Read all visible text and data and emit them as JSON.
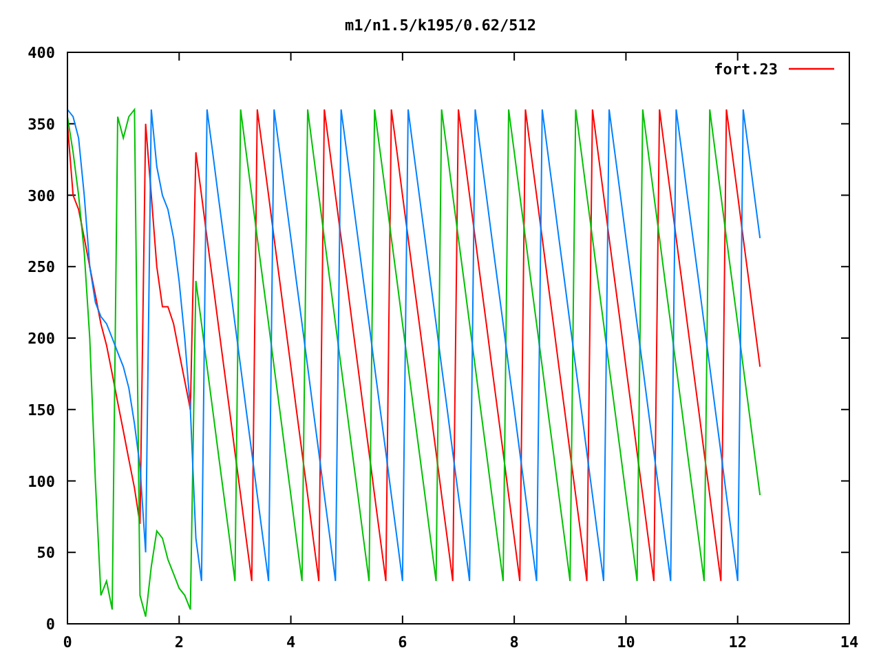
{
  "chart_data": {
    "type": "line",
    "title": "m1/n1.5/k195/0.62/512",
    "xlim": [
      0,
      14
    ],
    "ylim": [
      0,
      400
    ],
    "xticks": [
      0,
      2,
      4,
      6,
      8,
      10,
      12,
      14
    ],
    "yticks": [
      0,
      50,
      100,
      150,
      200,
      250,
      300,
      350,
      400
    ],
    "x": [
      0,
      0.1,
      0.2,
      0.3,
      0.4,
      0.5,
      0.6,
      0.7,
      0.8,
      0.9,
      1,
      1.1,
      1.2,
      1.3,
      1.4,
      1.5,
      1.6,
      1.7,
      1.8,
      1.9,
      2,
      2.1,
      2.2,
      2.3,
      2.4,
      2.5,
      2.6,
      2.7,
      2.8,
      2.9,
      3,
      3.1,
      3.2,
      3.3,
      3.4,
      3.5,
      3.6,
      3.7,
      3.8,
      3.9,
      4,
      4.1,
      4.2,
      4.3,
      4.4,
      4.5,
      4.6,
      4.7,
      4.8,
      4.9,
      5,
      5.1,
      5.2,
      5.3,
      5.4,
      5.5,
      5.6,
      5.7,
      5.8,
      5.9,
      6,
      6.1,
      6.2,
      6.3,
      6.4,
      6.5,
      6.6,
      6.7,
      6.8,
      6.9,
      7,
      7.1,
      7.2,
      7.3,
      7.4,
      7.5,
      7.6,
      7.7,
      7.8,
      7.9,
      8,
      8.1,
      8.2,
      8.3,
      8.4,
      8.5,
      8.6,
      8.7,
      8.8,
      8.9,
      9,
      9.1,
      9.2,
      9.3,
      9.4,
      9.5,
      9.6,
      9.7,
      9.8,
      9.9,
      10,
      10.1,
      10.2,
      10.3,
      10.4,
      10.5,
      10.6,
      10.7,
      10.8,
      10.9,
      11,
      11.1,
      11.2,
      11.3,
      11.4,
      11.5,
      11.6,
      11.7,
      11.8,
      11.9,
      12,
      12.1,
      12.2,
      12.3,
      12.4
    ],
    "series": [
      {
        "name": "fort.23",
        "color": "#ff0000",
        "values": [
          350,
          300,
          290,
          270,
          250,
          230,
          210,
          195,
          175,
          155,
          135,
          115,
          95,
          70,
          350,
          300,
          250,
          222,
          222,
          210,
          190,
          170,
          150,
          330,
          300,
          270,
          240,
          210,
          180,
          150,
          120,
          90,
          60,
          30,
          360,
          330,
          300,
          270,
          240,
          210,
          180,
          150,
          120,
          90,
          60,
          30,
          360,
          330,
          300,
          270,
          240,
          210,
          180,
          150,
          120,
          90,
          60,
          30,
          360,
          330,
          300,
          270,
          240,
          210,
          180,
          150,
          120,
          90,
          60,
          30,
          360,
          330,
          300,
          270,
          240,
          210,
          180,
          150,
          120,
          90,
          60,
          30,
          360,
          330,
          300,
          270,
          240,
          210,
          180,
          150,
          120,
          90,
          60,
          30,
          360,
          330,
          300,
          270,
          240,
          210,
          180,
          150,
          120,
          90,
          60,
          30,
          360,
          330,
          300,
          270,
          240,
          210,
          180,
          150,
          120,
          90,
          60,
          30,
          360,
          330,
          300,
          270,
          240,
          210,
          180
        ]
      },
      {
        "color": "#00c000",
        "values": [
          355,
          330,
          300,
          260,
          200,
          100,
          20,
          30,
          10,
          355,
          340,
          355,
          360,
          20,
          5,
          40,
          65,
          60,
          45,
          35,
          25,
          20,
          10,
          240,
          210,
          180,
          150,
          120,
          90,
          60,
          30,
          360,
          330,
          300,
          270,
          240,
          210,
          180,
          150,
          120,
          90,
          60,
          30,
          360,
          330,
          300,
          270,
          240,
          210,
          180,
          150,
          120,
          90,
          60,
          30,
          360,
          330,
          300,
          270,
          240,
          210,
          180,
          150,
          120,
          90,
          60,
          30,
          360,
          330,
          300,
          270,
          240,
          210,
          180,
          150,
          120,
          90,
          60,
          30,
          360,
          330,
          300,
          270,
          240,
          210,
          180,
          150,
          120,
          90,
          60,
          30,
          360,
          330,
          300,
          270,
          240,
          210,
          180,
          150,
          120,
          90,
          60,
          30,
          360,
          330,
          300,
          270,
          240,
          210,
          180,
          150,
          120,
          90,
          60,
          30,
          360,
          330,
          300,
          270,
          240,
          210,
          180,
          150,
          120,
          90
        ]
      },
      {
        "color": "#0080ff",
        "values": [
          360,
          355,
          340,
          300,
          250,
          225,
          215,
          210,
          200,
          190,
          180,
          165,
          140,
          110,
          50,
          360,
          320,
          300,
          290,
          270,
          240,
          200,
          150,
          60,
          30,
          360,
          330,
          300,
          270,
          240,
          210,
          180,
          150,
          120,
          90,
          60,
          30,
          360,
          330,
          300,
          270,
          240,
          210,
          180,
          150,
          120,
          90,
          60,
          30,
          360,
          330,
          300,
          270,
          240,
          210,
          180,
          150,
          120,
          90,
          60,
          30,
          360,
          330,
          300,
          270,
          240,
          210,
          180,
          150,
          120,
          90,
          60,
          30,
          360,
          330,
          300,
          270,
          240,
          210,
          180,
          150,
          120,
          90,
          60,
          30,
          360,
          330,
          300,
          270,
          240,
          210,
          180,
          150,
          120,
          90,
          60,
          30,
          360,
          330,
          300,
          270,
          240,
          210,
          180,
          150,
          120,
          90,
          60,
          30,
          360,
          330,
          300,
          270,
          240,
          210,
          180,
          150,
          120,
          90,
          60,
          30,
          360,
          330,
          300,
          270
        ]
      }
    ]
  }
}
